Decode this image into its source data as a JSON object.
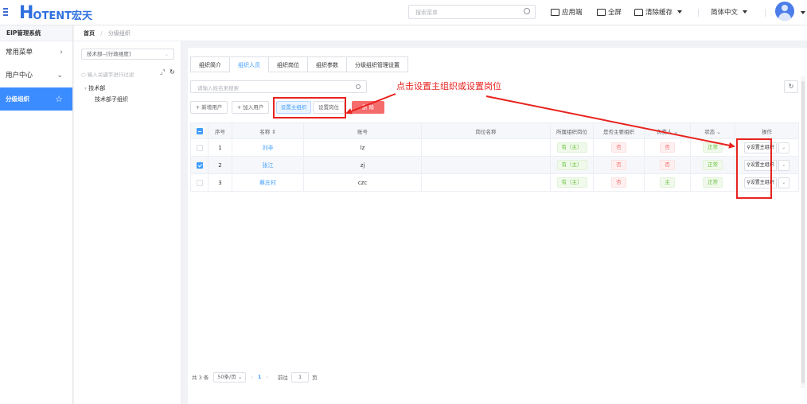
{
  "header": {
    "logo_big": "H",
    "logo_rest": "OTENT宏天",
    "search_placeholder": "搜索菜单",
    "app_label": "应用端",
    "fullscreen_label": "全屏",
    "clear_cache_label": "清除缓存",
    "language_label": "简体中文"
  },
  "sidebar": {
    "title": "EIP管理系统",
    "items": [
      {
        "label": "常用菜单",
        "arrow": "›"
      },
      {
        "label": "用户中心",
        "arrow": "⌄"
      },
      {
        "label": "分级组织",
        "arrow": "☆"
      }
    ]
  },
  "breadcrumb": {
    "home": "首页",
    "sep": "/",
    "current": "分级组织"
  },
  "tree": {
    "select_value": "技术部--[行政维度]",
    "search_placeholder": "输入关键字进行过滤",
    "nodes": [
      {
        "label": "技术部"
      },
      {
        "label": "技术部子组织"
      }
    ]
  },
  "tabs": [
    {
      "label": "组织简介"
    },
    {
      "label": "组织人员"
    },
    {
      "label": "组织岗位"
    },
    {
      "label": "组织参数"
    },
    {
      "label": "分级组织管理设置"
    }
  ],
  "search_placeholder": "请输入姓名来搜索",
  "toolbar": {
    "add_user": "+ 新增用户",
    "join_user": "+ 加入用户",
    "set_main_org": "设置主组织",
    "set_post": "设置岗位",
    "delete": "删 除"
  },
  "annotation": "点击设置主组织或设置岗位",
  "table": {
    "headers": [
      "序号",
      "名称 ⇕",
      "账号",
      "岗位名称",
      "所属组织岗位",
      "是否主要组织",
      "负责人 ⌄",
      "状态 ⌄",
      "操作"
    ],
    "rows": [
      {
        "no": "1",
        "name": "刘非",
        "account": "lz",
        "post": "",
        "org_post": "有（主）",
        "is_main": "否",
        "leader": "否",
        "status": "正常",
        "op": "设置主组织",
        "checked": false
      },
      {
        "no": "2",
        "name": "张江",
        "account": "zj",
        "post": "",
        "org_post": "有（主）",
        "is_main": "否",
        "leader": "否",
        "status": "正常",
        "op": "设置主组织",
        "checked": true
      },
      {
        "no": "3",
        "name": "蔡庄村",
        "account": "czc",
        "post": "",
        "org_post": "有（主）",
        "is_main": "否",
        "leader": "主",
        "status": "正常",
        "op": "设置主组织",
        "checked": false
      }
    ]
  },
  "pager": {
    "total": "共 3 条",
    "page_size": "50条/页",
    "current_page": "1",
    "goto_label": "前往",
    "goto_value": "1",
    "page_unit": "页"
  },
  "colors": {
    "accent": "#409eff",
    "annotation": "#e8231f",
    "sidebar_active": "#3b8cff"
  }
}
